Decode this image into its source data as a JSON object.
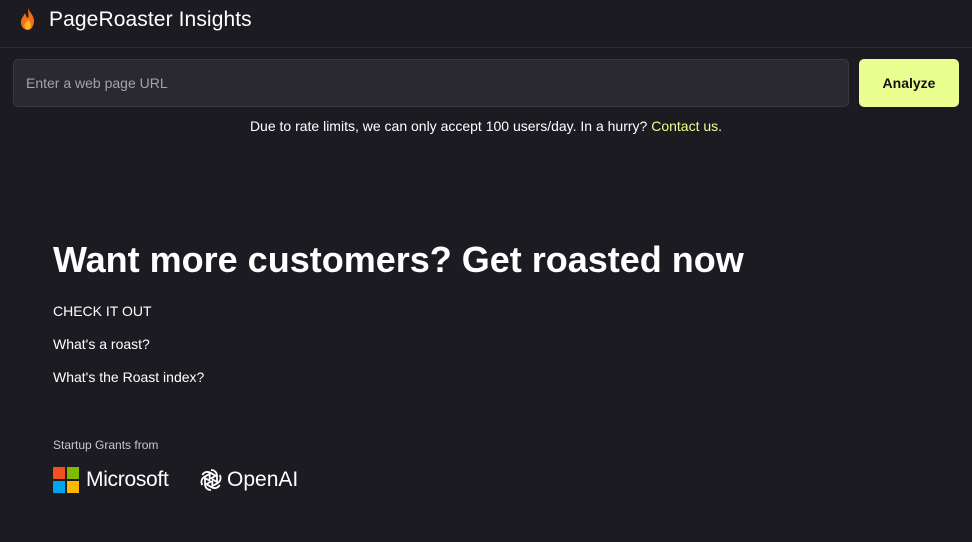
{
  "header": {
    "title": "PageRoaster Insights",
    "icon": "flame-icon"
  },
  "search": {
    "placeholder": "Enter a web page URL",
    "value": "",
    "button_label": "Analyze"
  },
  "notice": {
    "text": "Due to rate limits, we can only accept 100 users/day. In a hurry? ",
    "link_label": "Contact us",
    "suffix": "."
  },
  "hero": {
    "title": "Want more customers? Get roasted now"
  },
  "links": [
    {
      "label": "CHECK IT OUT"
    },
    {
      "label": "What's a roast?"
    },
    {
      "label": "What's the Roast index?"
    }
  ],
  "grants": {
    "label": "Startup Grants from",
    "sponsors": [
      {
        "name": "Microsoft",
        "icon": "microsoft-logo-icon"
      },
      {
        "name": "OpenAI",
        "icon": "openai-logo-icon"
      }
    ]
  },
  "colors": {
    "background": "#1c1b21",
    "accent": "#eaff8f",
    "input_bg": "#2a2931"
  }
}
